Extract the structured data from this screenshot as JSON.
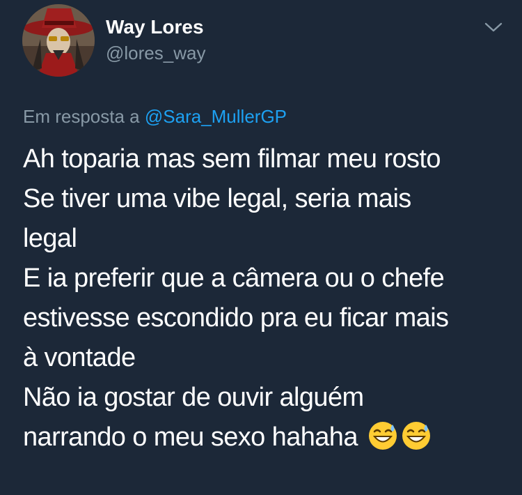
{
  "author": {
    "display_name": "Way Lores",
    "handle": "@lores_way",
    "avatar_icon": "hat-character-avatar"
  },
  "reply": {
    "prefix": "Em resposta a",
    "mention": "@Sara_MullerGP"
  },
  "tweet": {
    "lines": [
      "Ah toparia mas sem filmar meu rosto",
      "Se tiver uma vibe legal, seria mais",
      "legal",
      "E ia preferir que a câmera ou o chefe",
      "estivesse escondido pra eu ficar mais",
      "à vontade",
      "Não ia gostar de ouvir alguém",
      "narrando o meu sexo hahaha"
    ],
    "emoji": [
      "😅",
      "😅"
    ]
  },
  "colors": {
    "background": "#1c2838",
    "text_primary": "#ffffff",
    "text_secondary": "#8899a6",
    "link": "#1da1f2"
  },
  "icons": {
    "menu": "chevron-down-icon",
    "emoji": "grinning-sweat-emoji-icon"
  }
}
